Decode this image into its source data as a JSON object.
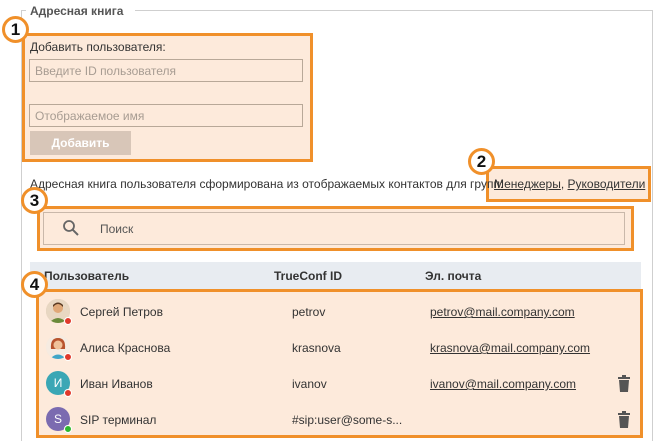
{
  "section_title": "Адресная книга",
  "add_user": {
    "label": "Добавить пользователя:",
    "id_placeholder": "Введите ID пользователя",
    "name_placeholder": "Отображаемое имя",
    "add_button": "Добавить"
  },
  "info_text": "Адресная книга пользователя сформирована из отображаемых контактов для групп:",
  "groups": [
    {
      "name": "Менеджеры"
    },
    {
      "name": "Руководители"
    }
  ],
  "group_separator": ",",
  "search": {
    "placeholder": "Поиск"
  },
  "table": {
    "headers": {
      "user": "Пользователь",
      "trueconf_id": "TrueConf ID",
      "email": "Эл. почта"
    },
    "rows": [
      {
        "name": "Сергей Петров",
        "id": "petrov",
        "email": "petrov@mail.company.com",
        "avatar": "photo-male",
        "status": "offline",
        "deletable": false
      },
      {
        "name": "Алиса Краснова",
        "id": "krasnova",
        "email": "krasnova@mail.company.com",
        "avatar": "photo-female",
        "status": "offline",
        "deletable": false
      },
      {
        "name": "Иван Иванов",
        "id": "ivanov",
        "email": "ivanov@mail.company.com",
        "avatar_letter": "И",
        "avatar_color": "#3aa7b5",
        "status": "offline",
        "deletable": true
      },
      {
        "name": "SIP терминал",
        "id": "#sip:user@some-s...",
        "email": "",
        "avatar_letter": "S",
        "avatar_color": "#7b6bb0",
        "status": "online",
        "deletable": true
      }
    ]
  },
  "callouts": [
    "1",
    "2",
    "3",
    "4"
  ],
  "colors": {
    "highlight_border": "#f0902a",
    "highlight_fill": "#fdeadb",
    "status_online": "#2eb82e",
    "status_offline": "#e0392b"
  }
}
